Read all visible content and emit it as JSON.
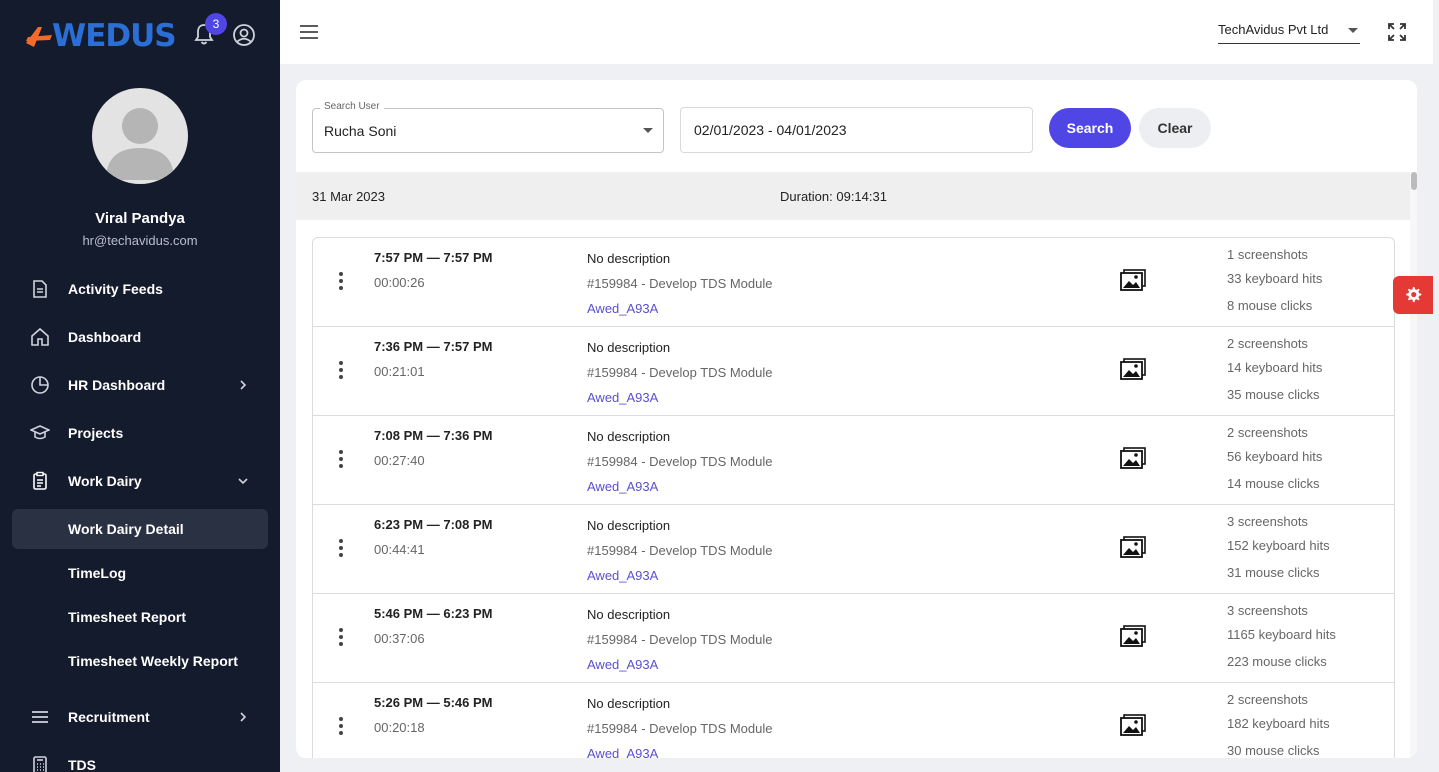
{
  "brand": {
    "logo_text": "WEDUS",
    "notification_count": "3"
  },
  "user": {
    "name": "Viral Pandya",
    "email": "hr@techavidus.com"
  },
  "sidebar": {
    "items": [
      {
        "label": "Activity Feeds",
        "icon": "document-icon"
      },
      {
        "label": "Dashboard",
        "icon": "home-icon"
      },
      {
        "label": "HR Dashboard",
        "icon": "pie-chart-icon"
      },
      {
        "label": "Projects",
        "icon": "graduation-cap-icon"
      },
      {
        "label": "Work Dairy",
        "icon": "clipboard-icon"
      },
      {
        "label": "Work Dairy Detail"
      },
      {
        "label": "TimeLog"
      },
      {
        "label": "Timesheet Report"
      },
      {
        "label": "Timesheet Weekly Report"
      },
      {
        "label": "Recruitment",
        "icon": "list-icon"
      },
      {
        "label": "TDS",
        "icon": "calculator-icon"
      }
    ]
  },
  "header": {
    "company": "TechAvidus Pvt Ltd"
  },
  "filters": {
    "user_label": "Search User",
    "user_value": "Rucha Soni",
    "date_range": "02/01/2023 - 04/01/2023",
    "search_label": "Search",
    "clear_label": "Clear"
  },
  "day": {
    "date": "31 Mar 2023",
    "duration": "Duration: 09:14:31"
  },
  "entries": [
    {
      "time": "7:57 PM — 7:57 PM",
      "duration": "00:00:26",
      "description": "No description",
      "task": "#159984 - Develop TDS Module",
      "employee": "Awed_A93A",
      "screenshots": "1 screenshots",
      "keyboard": "33 keyboard hits",
      "mouse": "8 mouse clicks"
    },
    {
      "time": "7:36 PM — 7:57 PM",
      "duration": "00:21:01",
      "description": "No description",
      "task": "#159984 - Develop TDS Module",
      "employee": "Awed_A93A",
      "screenshots": "2 screenshots",
      "keyboard": "14 keyboard hits",
      "mouse": "35 mouse clicks"
    },
    {
      "time": "7:08 PM — 7:36 PM",
      "duration": "00:27:40",
      "description": "No description",
      "task": "#159984 - Develop TDS Module",
      "employee": "Awed_A93A",
      "screenshots": "2 screenshots",
      "keyboard": "56 keyboard hits",
      "mouse": "14 mouse clicks"
    },
    {
      "time": "6:23 PM — 7:08 PM",
      "duration": "00:44:41",
      "description": "No description",
      "task": "#159984 - Develop TDS Module",
      "employee": "Awed_A93A",
      "screenshots": "3 screenshots",
      "keyboard": "152 keyboard hits",
      "mouse": "31 mouse clicks"
    },
    {
      "time": "5:46 PM — 6:23 PM",
      "duration": "00:37:06",
      "description": "No description",
      "task": "#159984 - Develop TDS Module",
      "employee": "Awed_A93A",
      "screenshots": "3 screenshots",
      "keyboard": "1165 keyboard hits",
      "mouse": "223 mouse clicks"
    },
    {
      "time": "5:26 PM — 5:46 PM",
      "duration": "00:20:18",
      "description": "No description",
      "task": "#159984 - Develop TDS Module",
      "employee": "Awed_A93A",
      "screenshots": "2 screenshots",
      "keyboard": "182 keyboard hits",
      "mouse": "30 mouse clicks"
    }
  ],
  "colors": {
    "sidebar_bg": "#141b2d",
    "accent": "#4f46e5",
    "danger": "#e53935",
    "link": "#5a4fcf"
  }
}
